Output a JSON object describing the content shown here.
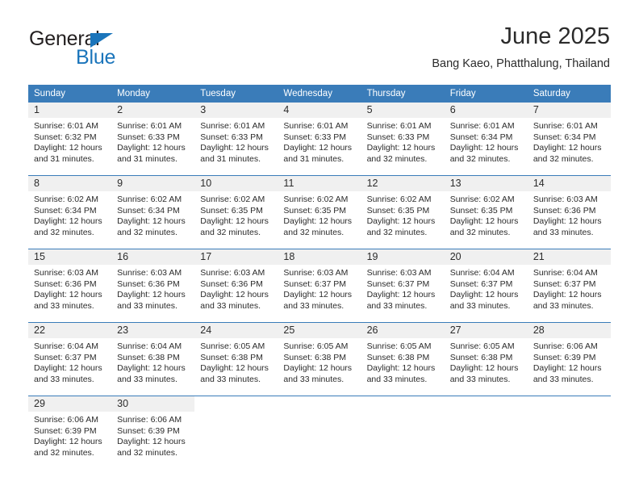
{
  "brand": {
    "name_part1": "General",
    "name_part2": "Blue",
    "accent_color": "#1b75bb",
    "triangle_icon": "triangle-icon"
  },
  "header": {
    "title": "June 2025",
    "location": "Bang Kaeo, Phatthalung, Thailand"
  },
  "calendar": {
    "header_bg": "#3a7cb9",
    "daynum_bg": "#f0f0f0",
    "weekday_headers": [
      "Sunday",
      "Monday",
      "Tuesday",
      "Wednesday",
      "Thursday",
      "Friday",
      "Saturday"
    ],
    "labels": {
      "sunrise": "Sunrise:",
      "sunset": "Sunset:",
      "daylight": "Daylight:"
    },
    "weeks": [
      [
        {
          "day": "1",
          "sunrise": "Sunrise: 6:01 AM",
          "sunset": "Sunset: 6:32 PM",
          "daylight_line1": "Daylight: 12 hours",
          "daylight_line2": "and 31 minutes."
        },
        {
          "day": "2",
          "sunrise": "Sunrise: 6:01 AM",
          "sunset": "Sunset: 6:33 PM",
          "daylight_line1": "Daylight: 12 hours",
          "daylight_line2": "and 31 minutes."
        },
        {
          "day": "3",
          "sunrise": "Sunrise: 6:01 AM",
          "sunset": "Sunset: 6:33 PM",
          "daylight_line1": "Daylight: 12 hours",
          "daylight_line2": "and 31 minutes."
        },
        {
          "day": "4",
          "sunrise": "Sunrise: 6:01 AM",
          "sunset": "Sunset: 6:33 PM",
          "daylight_line1": "Daylight: 12 hours",
          "daylight_line2": "and 31 minutes."
        },
        {
          "day": "5",
          "sunrise": "Sunrise: 6:01 AM",
          "sunset": "Sunset: 6:33 PM",
          "daylight_line1": "Daylight: 12 hours",
          "daylight_line2": "and 32 minutes."
        },
        {
          "day": "6",
          "sunrise": "Sunrise: 6:01 AM",
          "sunset": "Sunset: 6:34 PM",
          "daylight_line1": "Daylight: 12 hours",
          "daylight_line2": "and 32 minutes."
        },
        {
          "day": "7",
          "sunrise": "Sunrise: 6:01 AM",
          "sunset": "Sunset: 6:34 PM",
          "daylight_line1": "Daylight: 12 hours",
          "daylight_line2": "and 32 minutes."
        }
      ],
      [
        {
          "day": "8",
          "sunrise": "Sunrise: 6:02 AM",
          "sunset": "Sunset: 6:34 PM",
          "daylight_line1": "Daylight: 12 hours",
          "daylight_line2": "and 32 minutes."
        },
        {
          "day": "9",
          "sunrise": "Sunrise: 6:02 AM",
          "sunset": "Sunset: 6:34 PM",
          "daylight_line1": "Daylight: 12 hours",
          "daylight_line2": "and 32 minutes."
        },
        {
          "day": "10",
          "sunrise": "Sunrise: 6:02 AM",
          "sunset": "Sunset: 6:35 PM",
          "daylight_line1": "Daylight: 12 hours",
          "daylight_line2": "and 32 minutes."
        },
        {
          "day": "11",
          "sunrise": "Sunrise: 6:02 AM",
          "sunset": "Sunset: 6:35 PM",
          "daylight_line1": "Daylight: 12 hours",
          "daylight_line2": "and 32 minutes."
        },
        {
          "day": "12",
          "sunrise": "Sunrise: 6:02 AM",
          "sunset": "Sunset: 6:35 PM",
          "daylight_line1": "Daylight: 12 hours",
          "daylight_line2": "and 32 minutes."
        },
        {
          "day": "13",
          "sunrise": "Sunrise: 6:02 AM",
          "sunset": "Sunset: 6:35 PM",
          "daylight_line1": "Daylight: 12 hours",
          "daylight_line2": "and 32 minutes."
        },
        {
          "day": "14",
          "sunrise": "Sunrise: 6:03 AM",
          "sunset": "Sunset: 6:36 PM",
          "daylight_line1": "Daylight: 12 hours",
          "daylight_line2": "and 33 minutes."
        }
      ],
      [
        {
          "day": "15",
          "sunrise": "Sunrise: 6:03 AM",
          "sunset": "Sunset: 6:36 PM",
          "daylight_line1": "Daylight: 12 hours",
          "daylight_line2": "and 33 minutes."
        },
        {
          "day": "16",
          "sunrise": "Sunrise: 6:03 AM",
          "sunset": "Sunset: 6:36 PM",
          "daylight_line1": "Daylight: 12 hours",
          "daylight_line2": "and 33 minutes."
        },
        {
          "day": "17",
          "sunrise": "Sunrise: 6:03 AM",
          "sunset": "Sunset: 6:36 PM",
          "daylight_line1": "Daylight: 12 hours",
          "daylight_line2": "and 33 minutes."
        },
        {
          "day": "18",
          "sunrise": "Sunrise: 6:03 AM",
          "sunset": "Sunset: 6:37 PM",
          "daylight_line1": "Daylight: 12 hours",
          "daylight_line2": "and 33 minutes."
        },
        {
          "day": "19",
          "sunrise": "Sunrise: 6:03 AM",
          "sunset": "Sunset: 6:37 PM",
          "daylight_line1": "Daylight: 12 hours",
          "daylight_line2": "and 33 minutes."
        },
        {
          "day": "20",
          "sunrise": "Sunrise: 6:04 AM",
          "sunset": "Sunset: 6:37 PM",
          "daylight_line1": "Daylight: 12 hours",
          "daylight_line2": "and 33 minutes."
        },
        {
          "day": "21",
          "sunrise": "Sunrise: 6:04 AM",
          "sunset": "Sunset: 6:37 PM",
          "daylight_line1": "Daylight: 12 hours",
          "daylight_line2": "and 33 minutes."
        }
      ],
      [
        {
          "day": "22",
          "sunrise": "Sunrise: 6:04 AM",
          "sunset": "Sunset: 6:37 PM",
          "daylight_line1": "Daylight: 12 hours",
          "daylight_line2": "and 33 minutes."
        },
        {
          "day": "23",
          "sunrise": "Sunrise: 6:04 AM",
          "sunset": "Sunset: 6:38 PM",
          "daylight_line1": "Daylight: 12 hours",
          "daylight_line2": "and 33 minutes."
        },
        {
          "day": "24",
          "sunrise": "Sunrise: 6:05 AM",
          "sunset": "Sunset: 6:38 PM",
          "daylight_line1": "Daylight: 12 hours",
          "daylight_line2": "and 33 minutes."
        },
        {
          "day": "25",
          "sunrise": "Sunrise: 6:05 AM",
          "sunset": "Sunset: 6:38 PM",
          "daylight_line1": "Daylight: 12 hours",
          "daylight_line2": "and 33 minutes."
        },
        {
          "day": "26",
          "sunrise": "Sunrise: 6:05 AM",
          "sunset": "Sunset: 6:38 PM",
          "daylight_line1": "Daylight: 12 hours",
          "daylight_line2": "and 33 minutes."
        },
        {
          "day": "27",
          "sunrise": "Sunrise: 6:05 AM",
          "sunset": "Sunset: 6:38 PM",
          "daylight_line1": "Daylight: 12 hours",
          "daylight_line2": "and 33 minutes."
        },
        {
          "day": "28",
          "sunrise": "Sunrise: 6:06 AM",
          "sunset": "Sunset: 6:39 PM",
          "daylight_line1": "Daylight: 12 hours",
          "daylight_line2": "and 33 minutes."
        }
      ],
      [
        {
          "day": "29",
          "sunrise": "Sunrise: 6:06 AM",
          "sunset": "Sunset: 6:39 PM",
          "daylight_line1": "Daylight: 12 hours",
          "daylight_line2": "and 32 minutes."
        },
        {
          "day": "30",
          "sunrise": "Sunrise: 6:06 AM",
          "sunset": "Sunset: 6:39 PM",
          "daylight_line1": "Daylight: 12 hours",
          "daylight_line2": "and 32 minutes."
        },
        {
          "day": "",
          "sunrise": "",
          "sunset": "",
          "daylight_line1": "",
          "daylight_line2": ""
        },
        {
          "day": "",
          "sunrise": "",
          "sunset": "",
          "daylight_line1": "",
          "daylight_line2": ""
        },
        {
          "day": "",
          "sunrise": "",
          "sunset": "",
          "daylight_line1": "",
          "daylight_line2": ""
        },
        {
          "day": "",
          "sunrise": "",
          "sunset": "",
          "daylight_line1": "",
          "daylight_line2": ""
        },
        {
          "day": "",
          "sunrise": "",
          "sunset": "",
          "daylight_line1": "",
          "daylight_line2": ""
        }
      ]
    ]
  }
}
